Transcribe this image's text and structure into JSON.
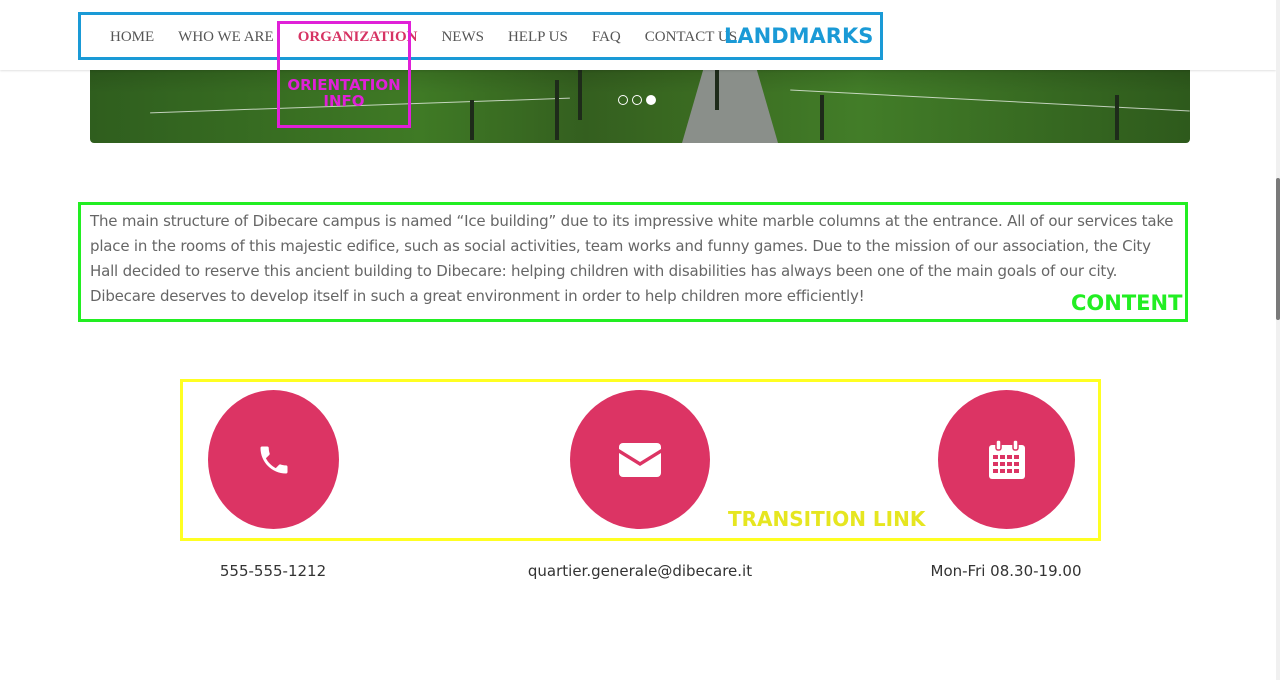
{
  "nav": {
    "items": [
      {
        "label": "HOME"
      },
      {
        "label": "WHO WE ARE"
      },
      {
        "label": "ORGANIZATION",
        "active": true
      },
      {
        "label": "NEWS"
      },
      {
        "label": "HELP US"
      },
      {
        "label": "FAQ"
      },
      {
        "label": "CONTACT US"
      }
    ]
  },
  "annotations": {
    "landmarks": {
      "label": "LANDMARKS",
      "color": "#1a9ad6"
    },
    "orientation": {
      "label_line1": "ORIENTATION",
      "label_line2": "INFO",
      "color": "#e020d8"
    },
    "content": {
      "label": "CONTENT",
      "color": "#22ee22"
    },
    "transition": {
      "label": "TRANSITION LINK",
      "color": "#ffff22"
    }
  },
  "slider": {
    "total_slides": 3,
    "active_slide": 3
  },
  "content": {
    "paragraph": "The main structure of Dibecare campus is named “Ice building” due to its impressive white marble columns at the entrance. All of our services take place in the rooms of this majestic edifice, such as social activities, team works and funny games. Due to the mission of our association, the City Hall decided to reserve this ancient building to Dibecare: helping children with disabilities has always been one of the main goals of our city. Dibecare deserves to develop itself in such a great environment in order to help children more efficiently!"
  },
  "contacts": {
    "phone": {
      "icon": "phone-icon",
      "text": "555-555-1212"
    },
    "email": {
      "icon": "envelope-icon",
      "text": "quartier.generale@dibecare.it"
    },
    "hours": {
      "icon": "calendar-icon",
      "text": "Mon-Fri 08.30-19.00"
    }
  },
  "colors": {
    "accent": "#dc3464",
    "nav_active": "#d63363"
  }
}
